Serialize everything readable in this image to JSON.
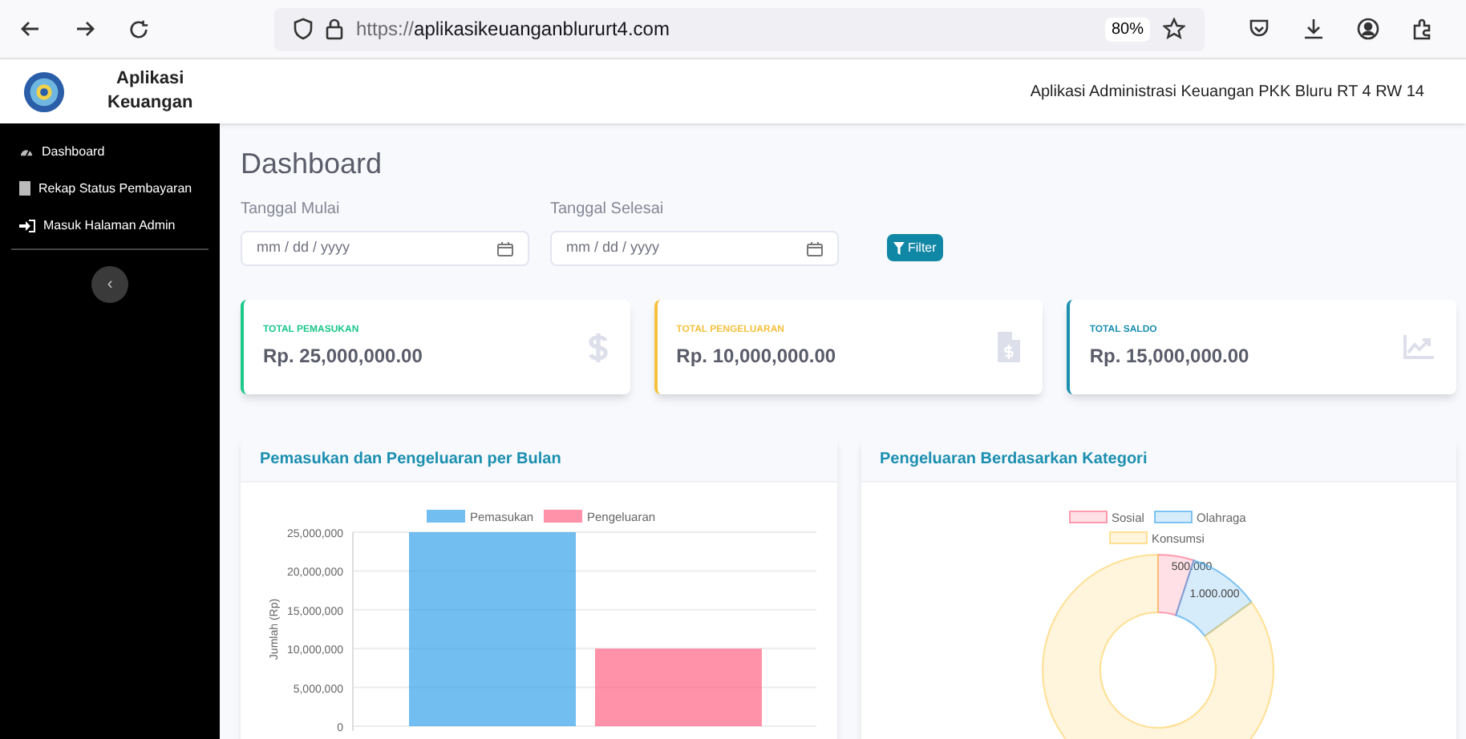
{
  "browser": {
    "url_scheme": "https://",
    "url_host": "aplikasikeuanganblururt4.com",
    "zoom": "80%"
  },
  "header": {
    "app_name_line1": "Aplikasi",
    "app_name_line2": "Keuangan",
    "subtitle": "Aplikasi Administrasi Keuangan PKK Bluru RT 4 RW 14"
  },
  "sidebar": {
    "items": [
      {
        "label": "Dashboard"
      },
      {
        "label": "Rekap Status Pembayaran"
      },
      {
        "label": "Masuk Halaman Admin"
      }
    ],
    "collapse_button": "‹"
  },
  "page_title": "Dashboard",
  "filters": [
    {
      "label": "Tanggal Mulai",
      "placeholder": "mm / dd / yyyy"
    },
    {
      "label": "Tanggal Selesai",
      "placeholder": "mm / dd / yyyy"
    }
  ],
  "filter_button": "Filter",
  "stats": [
    {
      "label": "TOTAL PEMASUKAN",
      "value": "Rp. 25,000,000.00",
      "color": "#1cc88a"
    },
    {
      "label": "TOTAL PENGELUARAN",
      "value": "Rp. 10,000,000.00",
      "color": "#f6c23e"
    },
    {
      "label": "TOTAL SALDO",
      "value": "Rp. 15,000,000.00",
      "color": "#1b8fb0"
    }
  ],
  "panels": [
    {
      "title": "Pemasukan dan Pengeluaran per Bulan",
      "chart_data": {
        "type": "bar",
        "ylabel": "Jumlah (Rp)",
        "ylim": [
          0,
          25000000
        ],
        "grid": true,
        "legend": true,
        "yticks": [
          {
            "value": 0,
            "label": "0"
          },
          {
            "value": 5000000,
            "label": "5,000,000"
          },
          {
            "value": 10000000,
            "label": "10,000,000"
          },
          {
            "value": 15000000,
            "label": "15,000,000"
          },
          {
            "value": 20000000,
            "label": "20,000,000"
          },
          {
            "value": 25000000,
            "label": "25,000,000"
          }
        ],
        "series": [
          {
            "name": "Pemasukan",
            "color": "#36a2eb",
            "values": [
              25000000
            ]
          },
          {
            "name": "Pengeluaran",
            "color": "#ff6384",
            "values": [
              10000000
            ]
          }
        ]
      }
    },
    {
      "title": "Pengeluaran Berdasarkan Kategori",
      "chart_data": {
        "type": "donut",
        "categories": [
          "Sosial",
          "Olahraga",
          "Konsumsi"
        ],
        "legend": true,
        "series": [
          {
            "colors": [
              "#ff6384",
              "#36a2eb",
              "#ffce56"
            ],
            "values": [
              5,
              10,
              85
            ]
          }
        ],
        "value_labels": [
          "500.000",
          "1.000.000"
        ]
      }
    }
  ]
}
